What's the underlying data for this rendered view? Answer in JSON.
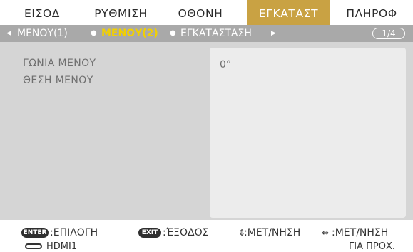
{
  "tabs": [
    {
      "label": "ΕΙΣΟΔ"
    },
    {
      "label": "ΡΥΘΜΙΣΗ"
    },
    {
      "label": "ΟΘΟΝΗ"
    },
    {
      "label": "ΕΓΚΑΤΑΣΤ",
      "active": true
    },
    {
      "label": "ΠΛΗΡΟΦ"
    }
  ],
  "subnav": {
    "items": [
      "ΜΕΝΟΥ(1)",
      "ΜΕΝΟΥ(2)",
      "ΕΓΚΑΤΑΣΤΑΣΗ"
    ],
    "current": "ΜΕΝΟΥ(2)",
    "page": "1/4"
  },
  "settings": [
    {
      "label": "ΓΩΝΙΑ ΜΕΝΟΥ",
      "value": "0°"
    },
    {
      "label": "ΘΕΣΗ ΜΕΝΟΥ"
    }
  ],
  "footer": {
    "hints": [
      {
        "key": "ENTER",
        "text": ":ΕΠΙΛΟΓΗ"
      },
      {
        "key": "EXIT",
        "text": ":ΈΞΟΔΟΣ"
      },
      {
        "icon": "up-down-arrows-icon",
        "text": ":ΜΕΤ/ΝΗΣΗ"
      },
      {
        "icon": "left-right-arrows-icon",
        "text": ":ΜΕΤ/ΝΗΣΗ"
      }
    ],
    "status": {
      "source_icon": "hdmi-icon",
      "source": "HDMI1",
      "right": "ΓΙΑ ΠΡΟΧ."
    }
  },
  "colors": {
    "active_tab": "#c9a243",
    "subnav_bg": "#a9a9a9",
    "current_item": "#f2d000",
    "panel_bg": "#d5d5d5"
  }
}
